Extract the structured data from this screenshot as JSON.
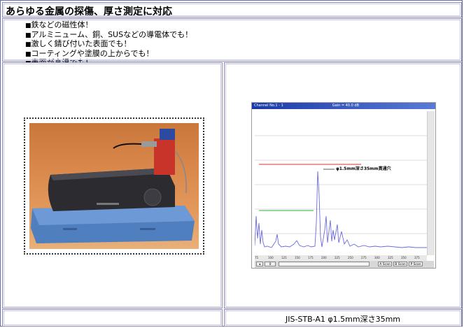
{
  "title": "あらゆる金属の探傷、厚さ測定に対応",
  "features": [
    "鉄などの磁性体！",
    "アルミニューム、銅、SUSなどの導電体でも！",
    "激しく錆び付いた表面でも！",
    "コーティングや塗膜の上からでも！",
    "表面が高温でも！"
  ],
  "bullet": "■",
  "scope": {
    "window_title": "Channel No.1 - 1",
    "gain": "Gain = 40.0 dB",
    "annotation": "φ1.5mm深さ35mm貫通穴",
    "ticks": [
      "75",
      "100",
      "125",
      "150",
      "175",
      "200",
      "225",
      "250",
      "275",
      "300",
      "325",
      "350",
      "375"
    ],
    "buttons": [
      "A Scan",
      "B Scan",
      "P Scan"
    ],
    "range_value": "0"
  },
  "caption": "JIS-STB-A1 φ1.5mm深さ35mm",
  "colors": {
    "border": "#8a8ac0",
    "trace": "#6a6ae0",
    "gate_red": "#e05a5a",
    "gate_green": "#5ac05a"
  }
}
